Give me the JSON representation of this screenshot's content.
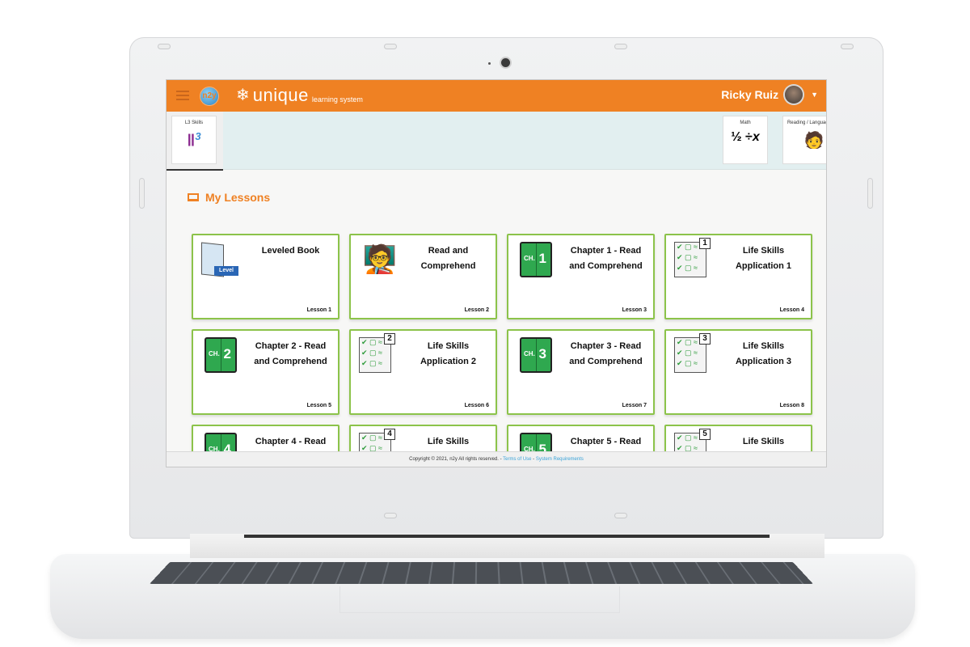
{
  "header": {
    "brand_name": "unique",
    "brand_sub": "learning system",
    "logo_text": "n2y",
    "user_name": "Ricky Ruiz"
  },
  "subjects": [
    {
      "label": "L3 Skills",
      "icon": "l3-skills-icon",
      "active": true
    },
    {
      "label": "Math",
      "icon": "math-symbols-icon",
      "active": false
    },
    {
      "label": "Reading / Language Arts",
      "icon": "reader-person-icon",
      "active": false
    }
  ],
  "section": {
    "title": "My Lessons",
    "icon": "laptop-icon"
  },
  "lessons": [
    {
      "title": "Leveled Book",
      "lesson": "Lesson 1",
      "icon": "leveled-book-icon"
    },
    {
      "title": "Read and Comprehend",
      "lesson": "Lesson 2",
      "icon": "reading-person-icon"
    },
    {
      "title": "Chapter 1 - Read and Comprehend",
      "lesson": "Lesson 3",
      "icon": "chapter-book-icon",
      "num": "1"
    },
    {
      "title": "Life Skills Application 1",
      "lesson": "Lesson 4",
      "icon": "checklist-icon",
      "num": "1"
    },
    {
      "title": "Chapter 2 - Read and Comprehend",
      "lesson": "Lesson 5",
      "icon": "chapter-book-icon",
      "num": "2"
    },
    {
      "title": "Life Skills Application 2",
      "lesson": "Lesson 6",
      "icon": "checklist-icon",
      "num": "2"
    },
    {
      "title": "Chapter 3 - Read and Comprehend",
      "lesson": "Lesson 7",
      "icon": "chapter-book-icon",
      "num": "3"
    },
    {
      "title": "Life Skills Application 3",
      "lesson": "Lesson 8",
      "icon": "checklist-icon",
      "num": "3"
    },
    {
      "title": "Chapter 4 - Read",
      "lesson": "",
      "icon": "chapter-book-icon",
      "num": "4"
    },
    {
      "title": "Life Skills",
      "lesson": "",
      "icon": "checklist-icon",
      "num": "4"
    },
    {
      "title": "Chapter 5 - Read",
      "lesson": "",
      "icon": "chapter-book-icon",
      "num": "5"
    },
    {
      "title": "Life Skills",
      "lesson": "",
      "icon": "checklist-icon",
      "num": "5"
    }
  ],
  "footer": {
    "copyright": "Copyright © 2021, n2y All rights reserved. - ",
    "terms": "Terms of Use",
    "sep": " - ",
    "requirements": "System Requirements"
  },
  "colors": {
    "brand_orange": "#ef8123",
    "card_border": "#8cc34a",
    "link": "#3aa3d8"
  }
}
